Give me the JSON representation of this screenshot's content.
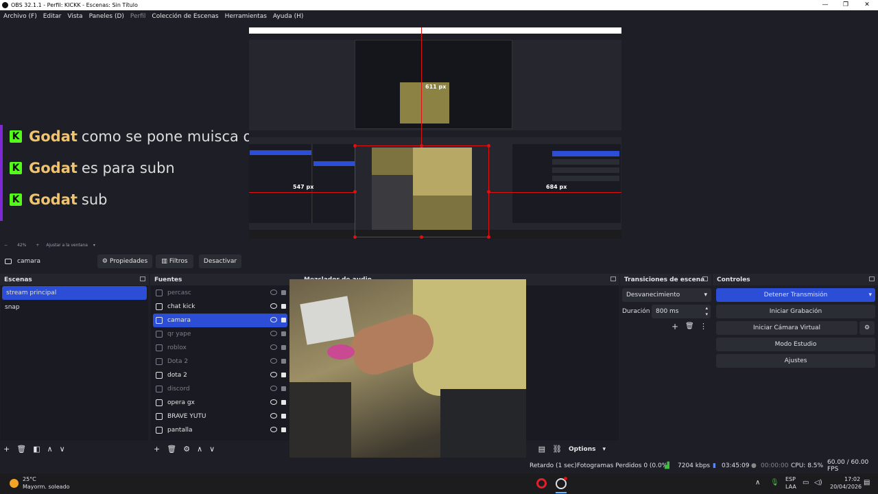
{
  "window": {
    "title": "OBS 32.1.1 - Perfil: KICKK - Escenas: Sin Título"
  },
  "menu": [
    "Archivo (F)",
    "Editar",
    "Vista",
    "Paneles (D)",
    "Perfil",
    "Colección de Escenas",
    "Herramientas",
    "Ayuda (H)"
  ],
  "preview": {
    "chat": [
      {
        "user": "Godat",
        "message": "como se pone muisca o solo"
      },
      {
        "user": "Godat",
        "message": "es para subn"
      },
      {
        "user": "Godat",
        "message": "sub"
      }
    ],
    "measure_top": "611 px",
    "measure_left": "547 px",
    "measure_right": "684 px",
    "zoom": "42%",
    "fit_label": "Ajustar a la ventana"
  },
  "source_toolbar": {
    "source_name": "camara",
    "properties": "Propiedades",
    "filters": "Filtros",
    "deactivate": "Desactivar"
  },
  "scenes": {
    "title": "Escenas",
    "items": [
      "stream principal",
      "snap"
    ],
    "selected": 0
  },
  "sources": {
    "title": "Fuentes",
    "items": [
      {
        "name": "percasc",
        "visible": false
      },
      {
        "name": "chat kick",
        "visible": true
      },
      {
        "name": "camara",
        "visible": true
      },
      {
        "name": "qr yape",
        "visible": false
      },
      {
        "name": "roblox",
        "visible": false
      },
      {
        "name": "Dota 2",
        "visible": false
      },
      {
        "name": "dota 2",
        "visible": true
      },
      {
        "name": "discord",
        "visible": false
      },
      {
        "name": "opera gx",
        "visible": true
      },
      {
        "name": "BRAVE YUTU",
        "visible": true
      },
      {
        "name": "pantalla",
        "visible": true
      }
    ],
    "selected": 2
  },
  "mixer": {
    "title": "Mezclador de audio",
    "options": "Options"
  },
  "transitions": {
    "title": "Transiciones de escena",
    "type": "Desvanecimiento",
    "duration_label": "Duración",
    "duration": "800 ms"
  },
  "controls": {
    "title": "Controles",
    "buttons": [
      "Detener Transmisión",
      "Iniciar Grabación",
      "Iniciar Cámara Virtual",
      "Modo Estudio",
      "Ajustes"
    ]
  },
  "status": {
    "delay": "Retardo (1 sec)",
    "dropped": "Fotogramas Perdidos 0 (0.0%)",
    "bitrate": "7204 kbps",
    "stream_time": "03:45:09",
    "rec_time": "00:00:00",
    "cpu": "CPU: 8.5%",
    "fps": "60.00 / 60.00 FPS"
  },
  "taskbar": {
    "weather_temp": "25°C",
    "weather_desc": "Mayorm. soleado",
    "lang_1": "ESP",
    "lang_2": "LAA",
    "time": "17:02",
    "date": "20/04/2026"
  },
  "colors": {
    "accent": "#2c4ed6",
    "kick_green": "#53fc18",
    "username": "#f0c36e",
    "measure_red": "#e01010"
  }
}
